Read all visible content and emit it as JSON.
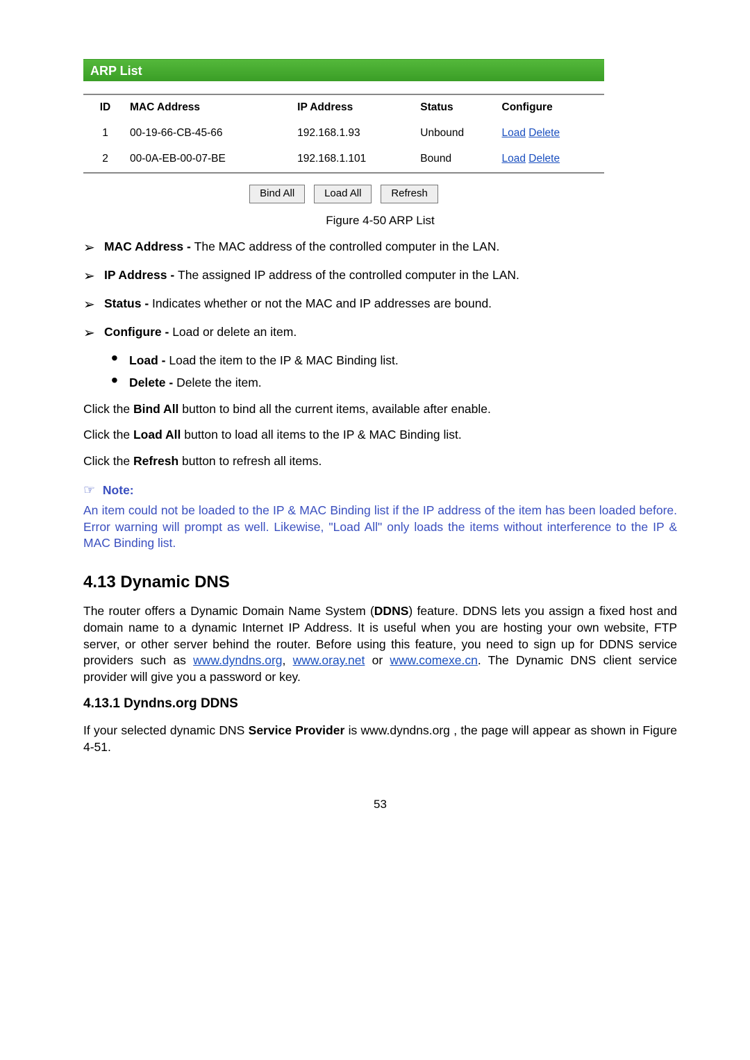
{
  "arp": {
    "title": "ARP List",
    "headers": {
      "id": "ID",
      "mac": "MAC Address",
      "ip": "IP Address",
      "status": "Status",
      "cfg": "Configure"
    },
    "rows": [
      {
        "id": "1",
        "mac": "00-19-66-CB-45-66",
        "ip": "192.168.1.93",
        "status": "Unbound",
        "load": "Load",
        "del": "Delete"
      },
      {
        "id": "2",
        "mac": "00-0A-EB-00-07-BE",
        "ip": "192.168.1.101",
        "status": "Bound",
        "load": "Load",
        "del": "Delete"
      }
    ],
    "buttons": {
      "bind": "Bind All",
      "load": "Load All",
      "refresh": "Refresh"
    },
    "caption": "Figure 4-50 ARP List"
  },
  "bullets": {
    "mac": {
      "label": "MAC Address - ",
      "text": "The MAC address of the controlled computer in the LAN."
    },
    "ip": {
      "label": "IP Address - ",
      "text": "The assigned IP address of the controlled computer in the LAN."
    },
    "stat": {
      "label": "Status - ",
      "text": "Indicates whether or not the MAC and IP addresses are bound."
    },
    "cfg": {
      "label": "Configure - ",
      "text": "Load or delete an item."
    },
    "load": {
      "label": "Load - ",
      "text": "Load the item to the IP & MAC Binding list."
    },
    "del": {
      "label": "Delete - ",
      "text": "Delete the item."
    }
  },
  "paras": {
    "p1a": "Click the ",
    "p1b": "Bind All",
    "p1c": " button to bind all the current items, available after enable.",
    "p2a": "Click the ",
    "p2b": "Load All",
    "p2c": " button to load all items to the IP & MAC Binding list.",
    "p3a": "Click the ",
    "p3b": "Refresh",
    "p3c": " button to refresh all items."
  },
  "note": {
    "title": "Note:",
    "body": "An item could not be loaded to the IP & MAC Binding list if the IP address of the item has been loaded before. Error warning will prompt as well. Likewise, \"Load All\" only loads the items without interference to the IP & MAC Binding list."
  },
  "sec": {
    "h": "4.13  Dynamic DNS",
    "p1a": "The router offers a Dynamic Domain Name System (",
    "p1b": "DDNS",
    "p1c": ") feature. DDNS lets you assign a fixed host and domain name to a dynamic Internet IP Address. It is useful when you are hosting your own website, FTP server, or other server behind the router. Before using this feature, you need to sign up for DDNS service providers such as ",
    "u1": "www.dyndns.org",
    "comma1": ", ",
    "u2": "www.oray.net",
    "or": " or ",
    "u3": "www.comexe.cn",
    "p1d": ". The Dynamic DNS client service provider will give you a password or key.",
    "sub": "4.13.1     Dyndns.org DDNS",
    "p2a": "If your selected dynamic DNS ",
    "p2b": "Service Provider",
    "p2c": " is www.dyndns.org , the page will appear as shown in Figure 4-51."
  },
  "pagenum": "53"
}
